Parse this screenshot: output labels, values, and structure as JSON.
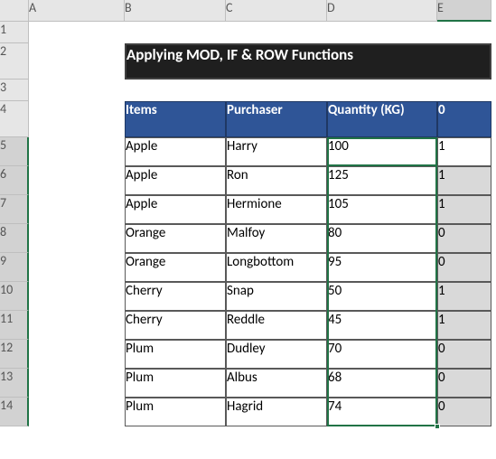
{
  "columns": [
    "A",
    "B",
    "C",
    "D",
    "E"
  ],
  "rows": [
    "1",
    "2",
    "3",
    "4",
    "5",
    "6",
    "7",
    "8",
    "9",
    "10",
    "11",
    "12",
    "13",
    "14"
  ],
  "title": "Applying MOD, IF & ROW Functions",
  "headers": {
    "items": "Items",
    "purchaser": "Purchaser",
    "quantity": "Quantity (KG)",
    "extra": "0"
  },
  "data": [
    {
      "items": "Apple",
      "purchaser": "Harry",
      "quantity": "100",
      "extra": "1",
      "gray": false
    },
    {
      "items": "Apple",
      "purchaser": "Ron",
      "quantity": "125",
      "extra": "1",
      "gray": true
    },
    {
      "items": "Apple",
      "purchaser": "Hermione",
      "quantity": "105",
      "extra": "1",
      "gray": true
    },
    {
      "items": "Orange",
      "purchaser": "Malfoy",
      "quantity": "80",
      "extra": "0",
      "gray": true
    },
    {
      "items": "Orange",
      "purchaser": "Longbottom",
      "quantity": "95",
      "extra": "0",
      "gray": true
    },
    {
      "items": "Cherry",
      "purchaser": "Snap",
      "quantity": "50",
      "extra": "1",
      "gray": true
    },
    {
      "items": "Cherry",
      "purchaser": "Reddle",
      "quantity": "45",
      "extra": "1",
      "gray": true
    },
    {
      "items": "Plum",
      "purchaser": "Dudley",
      "quantity": "70",
      "extra": "0",
      "gray": true
    },
    {
      "items": "Plum",
      "purchaser": "Albus",
      "quantity": "68",
      "extra": "0",
      "gray": true
    },
    {
      "items": "Plum",
      "purchaser": "Hagrid",
      "quantity": "74",
      "extra": "0",
      "gray": true
    }
  ],
  "active_cell": "E5",
  "selection_range": "E5:E14"
}
